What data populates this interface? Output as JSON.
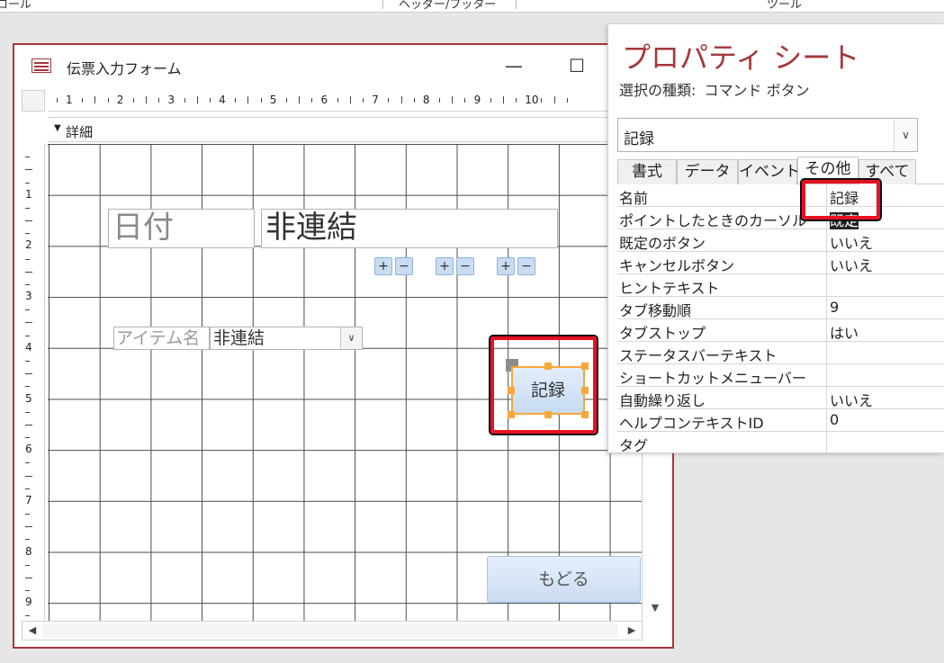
{
  "ribbon": {
    "group_left": "ロール",
    "group_middle": "ヘッダー/フッター",
    "group_right": "ツール"
  },
  "form_window": {
    "title": "伝票入力フォーム",
    "minimize": "—",
    "maximize": "☐",
    "section_label": "詳細",
    "ruler_numbers": [
      "1",
      "2",
      "3",
      "4",
      "5",
      "6",
      "7",
      "8",
      "9",
      "10"
    ],
    "vruler_numbers": [
      "1",
      "2",
      "3",
      "4",
      "5",
      "6",
      "7",
      "8",
      "9"
    ],
    "controls": {
      "date_label": "日付",
      "unbound_text": "非連結",
      "plus": "+",
      "minus": "−",
      "item_label": "アイテム名",
      "item_combo_value": "非連結",
      "record_button": "記録",
      "back_button": "もどる"
    }
  },
  "property_sheet": {
    "title": "プロパティ シート",
    "selection_label": "選択の種類:",
    "selection_type": "コマンド ボタン",
    "selected_object": "記録",
    "tabs": [
      "書式",
      "データ",
      "イベント",
      "その他",
      "すべて"
    ],
    "active_tab": "その他",
    "properties": [
      {
        "name": "名前",
        "value": "記録"
      },
      {
        "name": "ポイントしたときのカーソル",
        "value": "既定"
      },
      {
        "name": "既定のボタン",
        "value": "いいえ"
      },
      {
        "name": "キャンセルボタン",
        "value": "いいえ"
      },
      {
        "name": "ヒントテキスト",
        "value": ""
      },
      {
        "name": "タブ移動順",
        "value": "9"
      },
      {
        "name": "タブストップ",
        "value": "はい"
      },
      {
        "name": "ステータスバーテキスト",
        "value": ""
      },
      {
        "name": "ショートカットメニューバー",
        "value": ""
      },
      {
        "name": "自動繰り返し",
        "value": "いいえ"
      },
      {
        "name": "ヘルプコンテキストID",
        "value": "0"
      },
      {
        "name": "タグ",
        "value": ""
      }
    ]
  },
  "colors": {
    "accent": "#a4373a",
    "highlight": "#e81123",
    "selection_handle": "#f6a83a",
    "button_fill": "#c6daf2"
  }
}
